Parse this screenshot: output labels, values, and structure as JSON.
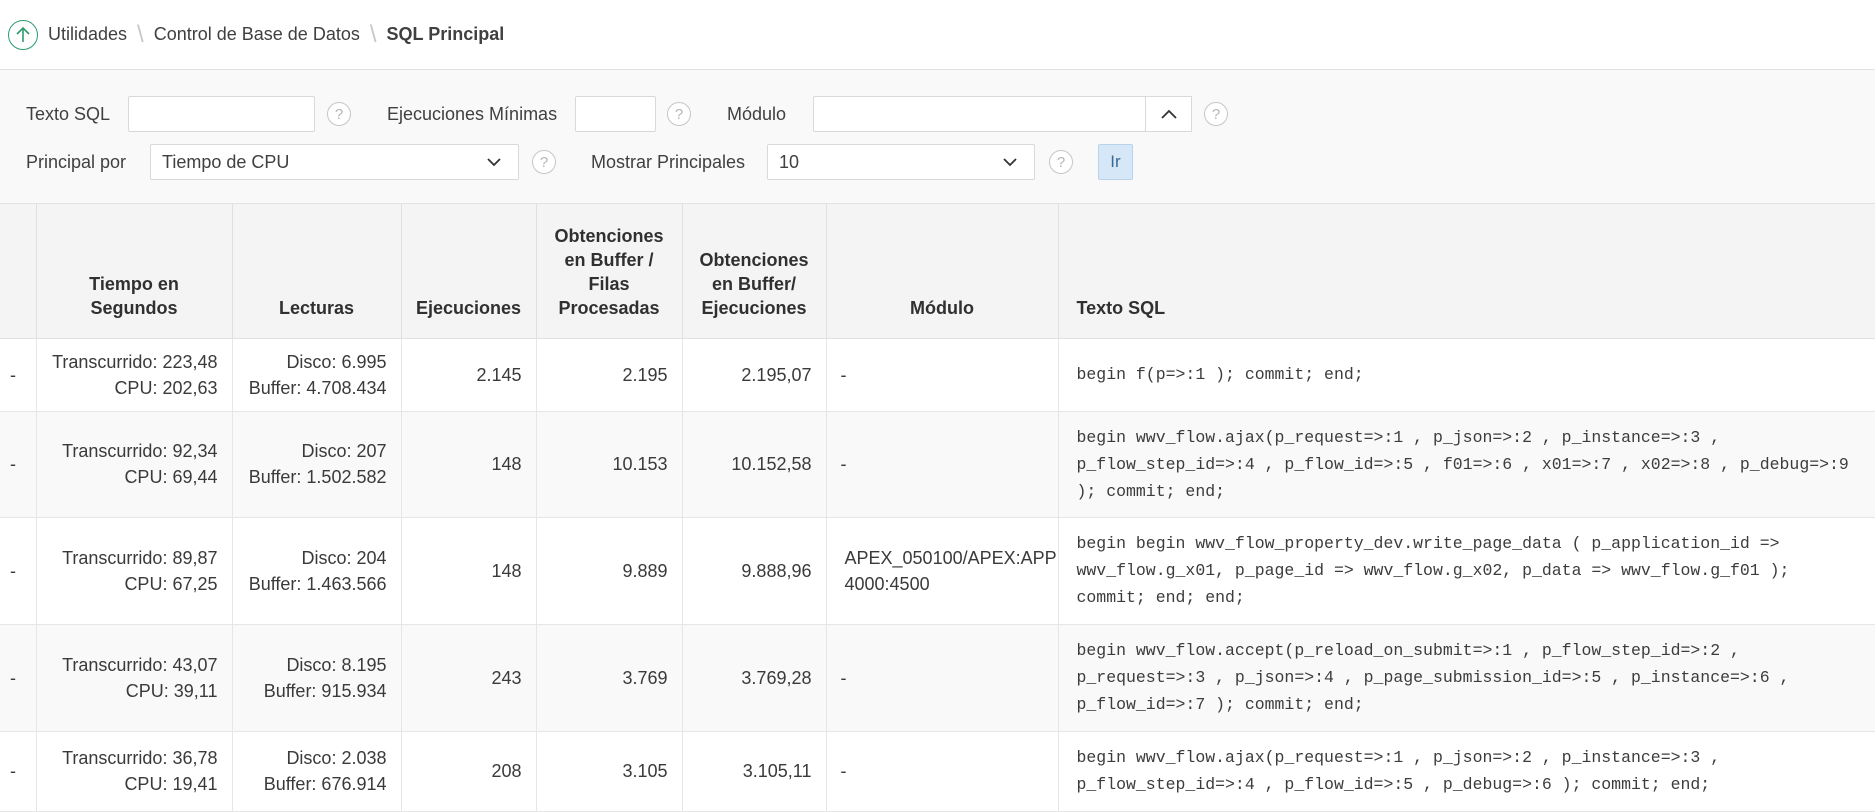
{
  "breadcrumb": {
    "items": [
      "Utilidades",
      "Control de Base de Datos"
    ],
    "current": "SQL Principal"
  },
  "filters": {
    "sql_text_label": "Texto SQL",
    "sql_text_value": "",
    "min_exec_label": "Ejecuciones Mínimas",
    "min_exec_value": "",
    "module_label": "Módulo",
    "module_value": "",
    "top_by_label": "Principal por",
    "top_by_value": "Tiempo de CPU",
    "show_top_label": "Mostrar Principales",
    "show_top_value": "10",
    "go_label": "Ir",
    "help_glyph": "?"
  },
  "table": {
    "headers": {
      "col0": "",
      "time": "Tiempo en Segundos",
      "reads": "Lecturas",
      "executions": "Ejecuciones",
      "buffer_gets_rows": "Obtenciones en Buffer / Filas Procesadas",
      "buffer_gets_exec": "Obtenciones en Buffer/ Ejecuciones",
      "module": "Módulo",
      "sql_text": "Texto SQL"
    },
    "rows": [
      {
        "c0": "-",
        "elapsed": "Transcurrido: 223,48",
        "cpu": "CPU: 202,63",
        "disk": "Disco: 6.995",
        "buffer": "Buffer: 4.708.434",
        "executions": "2.145",
        "gets_rows": "2.195",
        "gets_exec": "2.195,07",
        "module": "-",
        "sql": "begin f(p=>:1 ); commit; end;"
      },
      {
        "c0": "-",
        "elapsed": "Transcurrido: 92,34",
        "cpu": "CPU: 69,44",
        "disk": "Disco: 207",
        "buffer": "Buffer: 1.502.582",
        "executions": "148",
        "gets_rows": "10.153",
        "gets_exec": "10.152,58",
        "module": "-",
        "sql": "begin wwv_flow.ajax(p_request=>:1 , p_json=>:2 , p_instance=>:3 , p_flow_step_id=>:4 , p_flow_id=>:5 , f01=>:6 , x01=>:7 , x02=>:8 , p_debug=>:9 ); commit; end;"
      },
      {
        "c0": "-",
        "elapsed": "Transcurrido: 89,87",
        "cpu": "CPU: 67,25",
        "disk": "Disco: 204",
        "buffer": "Buffer: 1.463.566",
        "executions": "148",
        "gets_rows": "9.889",
        "gets_exec": "9.888,96",
        "module": "APEX_050100/APEX:APP 4000:4500",
        "sql": "begin begin wwv_flow_property_dev.write_page_data ( p_application_id => wwv_flow.g_x01, p_page_id => wwv_flow.g_x02, p_data => wwv_flow.g_f01 ); commit; end; end;"
      },
      {
        "c0": "-",
        "elapsed": "Transcurrido: 43,07",
        "cpu": "CPU: 39,11",
        "disk": "Disco: 8.195",
        "buffer": "Buffer: 915.934",
        "executions": "243",
        "gets_rows": "3.769",
        "gets_exec": "3.769,28",
        "module": "-",
        "sql": "begin wwv_flow.accept(p_reload_on_submit=>:1 , p_flow_step_id=>:2 , p_request=>:3 , p_json=>:4 , p_page_submission_id=>:5 , p_instance=>:6 , p_flow_id=>:7 ); commit; end;"
      },
      {
        "c0": "-",
        "elapsed": "Transcurrido: 36,78",
        "cpu": "CPU: 19,41",
        "disk": "Disco: 2.038",
        "buffer": "Buffer: 676.914",
        "executions": "208",
        "gets_rows": "3.105",
        "gets_exec": "3.105,11",
        "module": "-",
        "sql": "begin wwv_flow.ajax(p_request=>:1 , p_json=>:2 , p_instance=>:3 , p_flow_step_id=>:4 , p_flow_id=>:5 , p_debug=>:6 ); commit; end;"
      }
    ]
  }
}
